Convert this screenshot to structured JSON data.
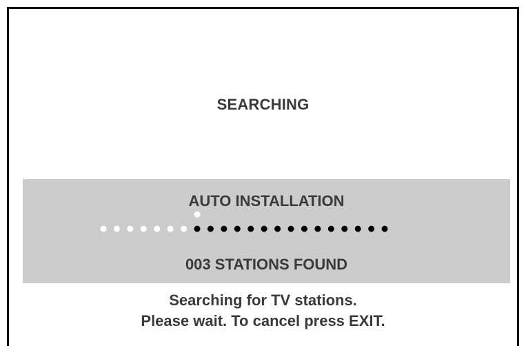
{
  "screen": {
    "title": "SEARCHING",
    "panel": {
      "heading": "AUTO INSTALLATION",
      "stations_found": "003 STATIONS FOUND",
      "progress": {
        "total_steps": 22,
        "completed_steps": 7
      }
    },
    "message": {
      "line1": "Searching for TV stations.",
      "line2": "Please wait. To cancel press EXIT."
    }
  },
  "colors": {
    "panel": "#cccccc",
    "text": "#3a3a3a",
    "border": "#000000",
    "dot_done": "#ffffff",
    "dot_pending": "#000000"
  }
}
